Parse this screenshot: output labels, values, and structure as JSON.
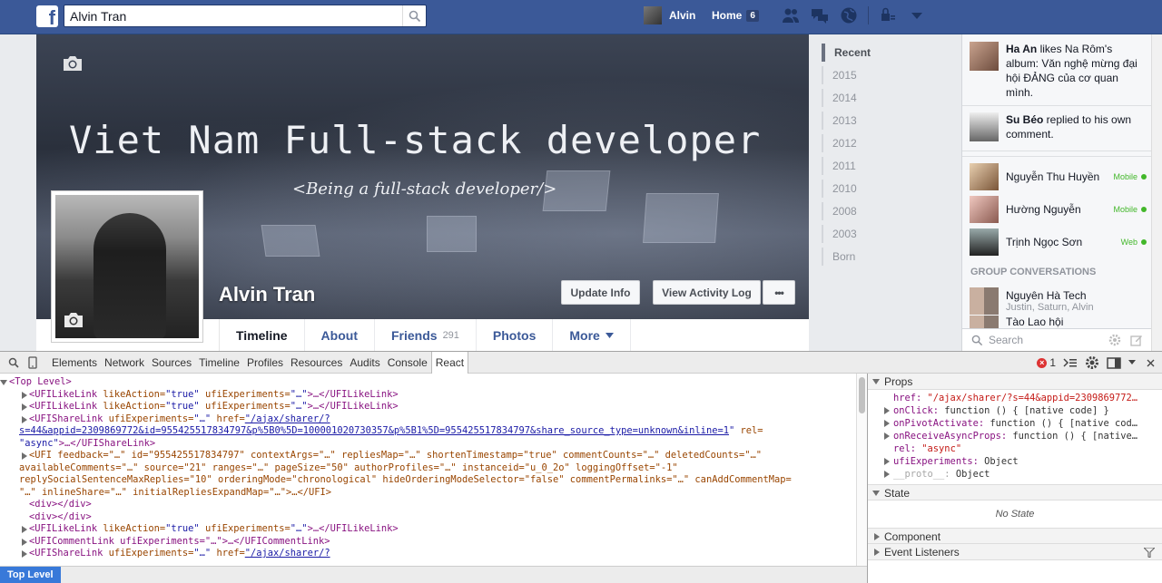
{
  "fb": {
    "logo": "f",
    "search_value": "Alvin Tran",
    "user_name": "Alvin",
    "home_label": "Home",
    "home_count": "6"
  },
  "cover": {
    "title": "Viet Nam Full-stack developer",
    "subtitle": "<Being a full-stack developer/>"
  },
  "profile": {
    "name": "Alvin Tran",
    "update_info": "Update Info",
    "view_activity_log": "View Activity Log",
    "more_dots": "•••"
  },
  "tabs": [
    {
      "label": "Timeline",
      "count": ""
    },
    {
      "label": "About",
      "count": ""
    },
    {
      "label": "Friends",
      "count": "291"
    },
    {
      "label": "Photos",
      "count": ""
    },
    {
      "label": "More",
      "count": ""
    }
  ],
  "years": [
    "Recent",
    "2015",
    "2014",
    "2013",
    "2012",
    "2011",
    "2010",
    "2008",
    "2003",
    "Born"
  ],
  "ticker": [
    {
      "actor": "Ha An",
      "text": " likes Na Rôm's album: Văn nghệ mừng đại hội ĐẢNG của cơ quan mình."
    },
    {
      "actor": "Su Béo",
      "text": " replied to his own comment."
    }
  ],
  "chat": [
    {
      "name": "Nguyễn Thu Huyền",
      "status": "Mobile"
    },
    {
      "name": "Hường Nguyễn",
      "status": "Mobile"
    },
    {
      "name": "Trịnh Ngọc Sơn",
      "status": "Web"
    }
  ],
  "group_heading": "GROUP CONVERSATIONS",
  "groups": [
    {
      "name": "Nguyên Hà Tech",
      "members": "Justin, Saturn, Alvin"
    },
    {
      "name": "Tào Lao hội",
      "members": ""
    }
  ],
  "chat_search_placeholder": "Search",
  "devtools": {
    "tabs": [
      "Elements",
      "Network",
      "Sources",
      "Timeline",
      "Profiles",
      "Resources",
      "Audits",
      "Console",
      "React"
    ],
    "active_tab": "React",
    "error_count": "1",
    "tree": {
      "top": "<Top Level>",
      "l1a": "<UFILikeLink",
      "l1b": " likeAction=",
      "l1c": "\"true\"",
      "l1d": " ufiExperiments=",
      "l1e": "\"…\"",
      "l1f": ">…</UFILikeLink>",
      "share_open": "<UFIShareLink",
      "share_exp": " ufiExperiments=",
      "share_exp_v": "\"…\"",
      "share_href": " href=",
      "share_href_v1": "\"/ajax/sharer/?",
      "share_href_v2": "s=44&appid=2309869772&id=955425517834797&p%5B0%5D=100001020730357&p%5B1%5D=955425517834797&share_source_type=unknown&inline=1",
      "share_href_v3": "\"",
      "share_rel": " rel=",
      "share_rel_v": "\"async\"",
      "share_close": ">…</UFIShareLink>",
      "ufi1": "<UFI feedback=\"…\" id=\"955425517834797\" contextArgs=\"…\" repliesMap=\"…\" shortenTimestamp=\"true\" commentCounts=\"…\" deletedCounts=\"…\"",
      "ufi2": "availableComments=\"…\" source=\"21\" ranges=\"…\" pageSize=\"50\" authorProfiles=\"…\" instanceid=\"u_0_2o\" loggingOffset=\"-1\"",
      "ufi3": "replySocialSentenceMaxReplies=\"10\" orderingMode=\"chronological\" hideOrderingModeSelector=\"false\" commentPermalinks=\"…\" canAddCommentMap=",
      "ufi4": "\"…\" inlineShare=\"…\" initialRepliesExpandMap=\"…\">…</UFI>",
      "div1": "<div></div>",
      "div2": "<div></div>",
      "comment": "<UFICommentLink ufiExperiments=\"…\">…</UFICommentLink>",
      "share2a": "<UFIShareLink",
      "share2b": " ufiExperiments=",
      "share2c": "\"…\"",
      "share2d": " href=",
      "share2e": "\"/ajax/sharer/?"
    },
    "props_heading": "Props",
    "props": {
      "href_k": "href:",
      "href_v": " \"/ajax/sharer/?s=44&appid=2309869772…",
      "onclick_k": "onClick:",
      "onclick_v": " function () { [native code] }",
      "onpivot_k": "onPivotActivate:",
      "onpivot_v": " function () { [native cod…",
      "onreceive_k": "onReceiveAsyncProps:",
      "onreceive_v": " function () { [native…",
      "rel_k": "rel:",
      "rel_v": " \"async\"",
      "ufi_k": "ufiExperiments:",
      "ufi_v": " Object",
      "proto_k": "__proto__:",
      "proto_v": " Object"
    },
    "state_heading": "State",
    "no_state": "No State",
    "component_heading": "Component",
    "event_heading": "Event Listeners",
    "breadcrumb": "Top Level"
  },
  "colors": {
    "fb_blue": "#3b5998",
    "online_green": "#42b72a",
    "devtools_select": "#3879d9"
  }
}
